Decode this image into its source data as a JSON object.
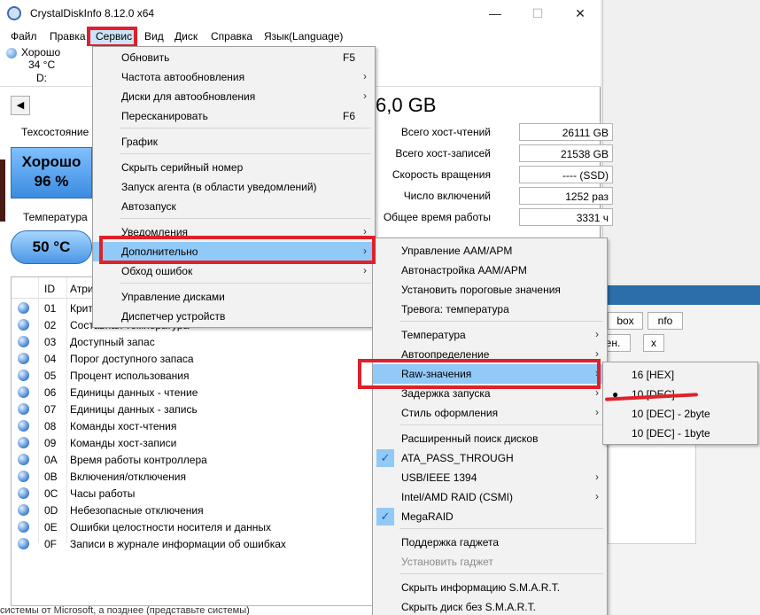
{
  "window": {
    "title": "CrystalDiskInfo 8.12.0 x64",
    "minimize_glyph": "—",
    "maximize_glyph": "☐",
    "close_glyph": "✕"
  },
  "menubar": {
    "file": "Файл",
    "edit": "Правка",
    "service": "Сервис",
    "view": "Вид",
    "disk": "Диск",
    "help": "Справка",
    "language": "Язык(Language)"
  },
  "drive": {
    "status": "Хорошо",
    "temp": "34 °C",
    "letter": "D:"
  },
  "disk_info": {
    "size": "6,0 GB",
    "health_label": "Техсостояние",
    "health_status": "Хорошо",
    "health_percent": "96 %",
    "temp_label": "Температура",
    "temp_value": "50 °C",
    "stats": [
      {
        "key": "Всего хост-чтений",
        "value": "26111 GB"
      },
      {
        "key": "Всего хост-записей",
        "value": "21538 GB"
      },
      {
        "key": "Скорость вращения",
        "value": "---- (SSD)"
      },
      {
        "key": "Число включений",
        "value": "1252 раз"
      },
      {
        "key": "Общее время работы",
        "value": "3331 ч"
      }
    ]
  },
  "smart_table": {
    "col_id": "ID",
    "col_attr": "Атрибут",
    "rows": [
      {
        "id": "01",
        "name": "Критические предупреждения"
      },
      {
        "id": "02",
        "name": "Составная температура"
      },
      {
        "id": "03",
        "name": "Доступный запас"
      },
      {
        "id": "04",
        "name": "Порог доступного запаса"
      },
      {
        "id": "05",
        "name": "Процент использования"
      },
      {
        "id": "06",
        "name": "Единицы данных - чтение"
      },
      {
        "id": "07",
        "name": "Единицы данных - запись"
      },
      {
        "id": "08",
        "name": "Команды хост-чтения"
      },
      {
        "id": "09",
        "name": "Команды хост-записи"
      },
      {
        "id": "0A",
        "name": "Время работы контроллера"
      },
      {
        "id": "0B",
        "name": "Включения/отключения"
      },
      {
        "id": "0C",
        "name": "Часы работы"
      },
      {
        "id": "0D",
        "name": "Небезопасные отключения"
      },
      {
        "id": "0E",
        "name": "Ошибки целостности носителя и данных"
      },
      {
        "id": "0F",
        "name": "Записи в журнале информации об ошибках"
      }
    ]
  },
  "service_menu": {
    "items": [
      {
        "label": "Обновить",
        "shortcut": "F5",
        "arrow": ""
      },
      {
        "label": "Частота автообновления",
        "shortcut": "",
        "arrow": "›"
      },
      {
        "label": "Диски для автообновления",
        "shortcut": "",
        "arrow": "›"
      },
      {
        "label": "Пересканировать",
        "shortcut": "F6",
        "arrow": ""
      },
      {
        "label": "График",
        "shortcut": "",
        "arrow": ""
      },
      {
        "label": "Скрыть серийный номер",
        "shortcut": "",
        "arrow": ""
      },
      {
        "label": "Запуск агента (в области уведомлений)",
        "shortcut": "",
        "arrow": ""
      },
      {
        "label": "Автозапуск",
        "shortcut": "",
        "arrow": ""
      },
      {
        "label": "Уведомления",
        "shortcut": "",
        "arrow": "›"
      },
      {
        "label": "Дополнительно",
        "shortcut": "",
        "arrow": "›"
      },
      {
        "label": "Обход ошибок",
        "shortcut": "",
        "arrow": "›"
      },
      {
        "label": "Управление дисками",
        "shortcut": "",
        "arrow": ""
      },
      {
        "label": "Диспетчер устройств",
        "shortcut": "",
        "arrow": ""
      }
    ]
  },
  "advanced_menu": {
    "items": [
      {
        "label": "Управление AAM/APM",
        "arrow": ""
      },
      {
        "label": "Автонастройка AAM/APM",
        "arrow": ""
      },
      {
        "label": "Установить пороговые значения",
        "arrow": ""
      },
      {
        "label": "Тревога: температура",
        "arrow": ""
      },
      {
        "label": "Температура",
        "arrow": "›"
      },
      {
        "label": "Автоопределение",
        "arrow": "›"
      },
      {
        "label": "Raw-значения",
        "arrow": "›"
      },
      {
        "label": "Задержка запуска",
        "arrow": "›"
      },
      {
        "label": "Стиль оформления",
        "arrow": "›"
      },
      {
        "label": "Расширенный поиск дисков",
        "arrow": ""
      },
      {
        "label": "ATA_PASS_THROUGH",
        "arrow": ""
      },
      {
        "label": "USB/IEEE 1394",
        "arrow": "›"
      },
      {
        "label": "Intel/AMD RAID (CSMI)",
        "arrow": "›"
      },
      {
        "label": "MegaRAID",
        "arrow": ""
      },
      {
        "label": "Поддержка гаджета",
        "arrow": ""
      },
      {
        "label": "Установить гаджет",
        "arrow": ""
      },
      {
        "label": "Скрыть информацию S.M.A.R.T.",
        "arrow": ""
      },
      {
        "label": "Скрыть диск без S.M.A.R.T.",
        "arrow": ""
      }
    ],
    "check_glyph": "✓"
  },
  "raw_menu": {
    "items": [
      {
        "label": "16 [HEX]"
      },
      {
        "label": "10 [DEC]"
      },
      {
        "label": "10 [DEC] - 2byte"
      },
      {
        "label": "10 [DEC] - 1byte"
      }
    ],
    "bullet_glyph": "●"
  },
  "background_app": {
    "btn_box": "box",
    "btn_nfo": "nfo",
    "btn_en": "ен.",
    "btn_x": "x",
    "bottom_text": "системы от Microsoft, а позднее (представьте системы)"
  }
}
